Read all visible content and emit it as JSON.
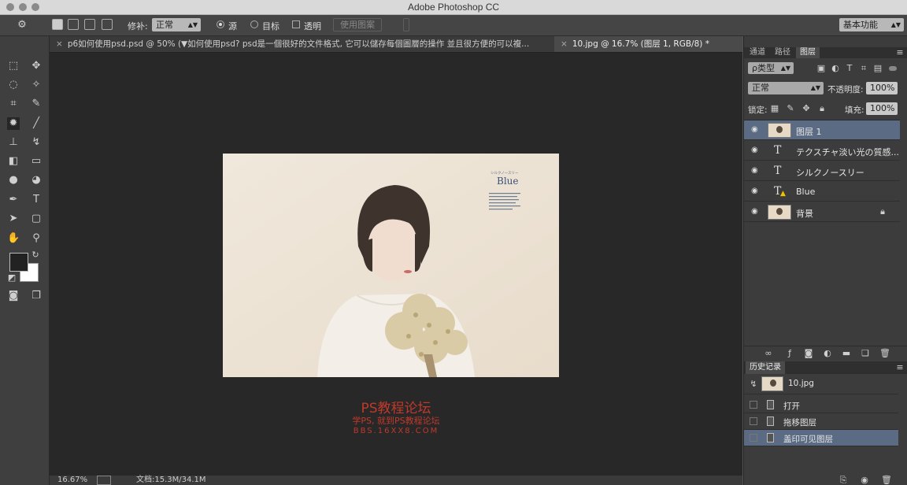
{
  "window": {
    "title": "Adobe Photoshop CC"
  },
  "options": {
    "tip_label": "修补:",
    "tip_mode": "正常",
    "source_label": "源",
    "target_label": "目标",
    "transparent_label": "透明",
    "use_pattern_label": "使用图案",
    "workspace": "基本功能"
  },
  "tabs": [
    {
      "label": "p6如何使用psd.psd @ 50% (▼如何使用psd?  psd是一個很好的文件格式, 它可以儲存每個圖層的操作 並且很方便的可以複..."
    },
    {
      "label": "10.jpg @ 16.7% (图层 1, RGB/8) *"
    }
  ],
  "canvas_text": {
    "kana": "シルクノースリー",
    "title": "Blue"
  },
  "watermark": {
    "line1": "PS教程论坛",
    "line2": "学PS, 就到PS教程论坛",
    "line3": "BBS.16XX8.COM"
  },
  "status": {
    "zoom": "16.67%",
    "doc": "文档:15.3M/34.1M"
  },
  "panel_tabs": [
    "通道",
    "路径",
    "图层"
  ],
  "layers_panel": {
    "filter": "ρ类型",
    "blend_mode": "正常",
    "opacity_label": "不透明度:",
    "opacity_value": "100%",
    "lock_label": "锁定:",
    "fill_label": "填充:",
    "fill_value": "100%"
  },
  "layers": [
    {
      "name": "图层 1"
    },
    {
      "name": "テクスチャ淡い光の質感..."
    },
    {
      "name": "シルクノースリー"
    },
    {
      "name": "Blue"
    },
    {
      "name": "背景"
    }
  ],
  "history": {
    "tab": "历史记录",
    "snapshot": "10.jpg",
    "items": [
      {
        "name": "打开"
      },
      {
        "name": "拖移图层"
      },
      {
        "name": "盖印可见图层"
      }
    ]
  },
  "colors": {
    "selection": "#5b6b84",
    "watermark": "#c0392b"
  }
}
